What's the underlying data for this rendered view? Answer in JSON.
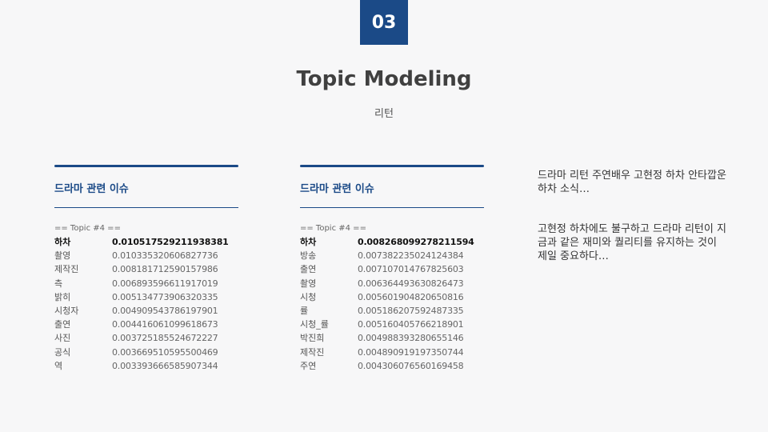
{
  "badge": "03",
  "title": "Topic Modeling",
  "subtitle": "리턴",
  "panels": [
    {
      "title": "드라마 관련 이슈",
      "topic_header": "== Topic #4 ==",
      "rows": [
        {
          "word": "하차",
          "score": "0.010517529211938381"
        },
        {
          "word": "촬영",
          "score": "0.010335320606827736"
        },
        {
          "word": "제작진",
          "score": "0.008181712590157986"
        },
        {
          "word": "측",
          "score": "0.006893596611917019"
        },
        {
          "word": "밝히",
          "score": "0.005134773906320335"
        },
        {
          "word": "시청자",
          "score": "0.004909543786197901"
        },
        {
          "word": "출연",
          "score": "0.004416061099618673"
        },
        {
          "word": "사진",
          "score": "0.003725185524672227"
        },
        {
          "word": "공식",
          "score": "0.003669510595500469"
        },
        {
          "word": "역",
          "score": "0.003393666585907344"
        }
      ]
    },
    {
      "title": "드라마 관련 이슈",
      "topic_header": "== Topic #4 ==",
      "rows": [
        {
          "word": "하차",
          "score": "0.008268099278211594"
        },
        {
          "word": "방송",
          "score": "0.007382235024124384"
        },
        {
          "word": "출연",
          "score": "0.007107014767825603"
        },
        {
          "word": "촬영",
          "score": "0.006364493630826473"
        },
        {
          "word": "시청",
          "score": "0.005601904820650816"
        },
        {
          "word": "률",
          "score": "0.005186207592487335"
        },
        {
          "word": "시청_률",
          "score": "0.005160405766218901"
        },
        {
          "word": "박진희",
          "score": "0.004988393280655146"
        },
        {
          "word": "제작진",
          "score": "0.004890919197350744"
        },
        {
          "word": "주연",
          "score": "0.004306076560169458"
        }
      ]
    }
  ],
  "notes": [
    "드라마 리턴 주연배우 고현정 하차 안타깝운 하차 소식…",
    "고현정 하차에도 불구하고 드라마 리턴이 지금과 같은 재미와 퀄리티를 유지하는 것이 제일 중요하다…"
  ]
}
